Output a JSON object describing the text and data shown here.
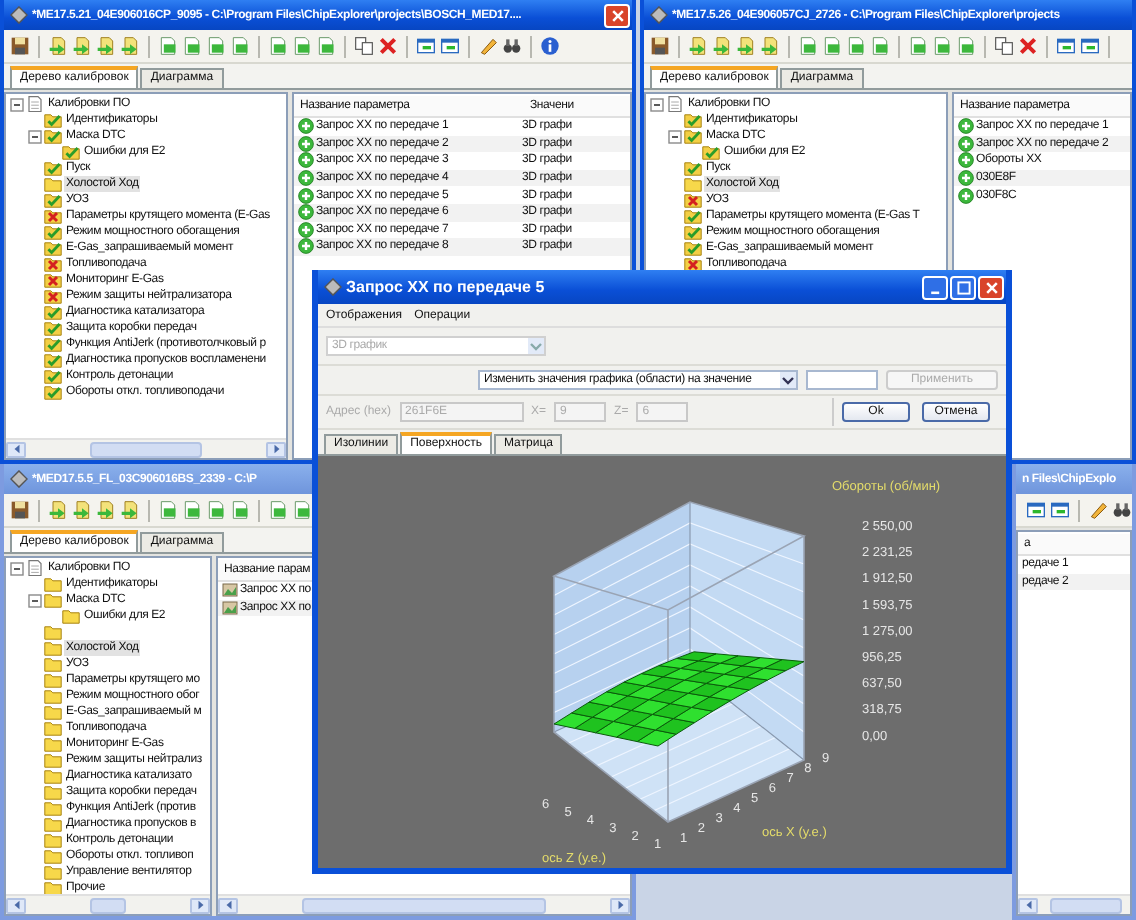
{
  "windows": [
    {
      "title": "*ME17.5.21_04E906016CP_9095 - C:\\Program Files\\ChipExplorer\\projects\\BOSCH_MED17....",
      "active": true,
      "close_button": true,
      "tabs": [
        {
          "label": "Дерево калибровок",
          "selected": true
        },
        {
          "label": "Диаграмма",
          "selected": false
        }
      ],
      "tree": [
        {
          "label": "Калибровки ПО",
          "kind": "root",
          "selected": false,
          "expanded": true,
          "children": [
            {
              "label": "Идентификаторы",
              "kind": "ok",
              "selected": false
            },
            {
              "label": "Маска DTC",
              "kind": "ok",
              "selected": false,
              "expanded": true,
              "children": [
                {
                  "label": "Ошибки для E2",
                  "kind": "ok",
                  "selected": false
                }
              ]
            },
            {
              "label": "Пуск",
              "kind": "ok",
              "selected": false
            },
            {
              "label": "Холостой Ход",
              "kind": "folder",
              "selected": true
            },
            {
              "label": "УОЗ",
              "kind": "ok",
              "selected": false
            },
            {
              "label": "Параметры крутящего момента (E-Gas",
              "kind": "error",
              "selected": false
            },
            {
              "label": "Режим мощностного обогащения",
              "kind": "ok",
              "selected": false
            },
            {
              "label": "E-Gas_запрашиваемый момент",
              "kind": "ok",
              "selected": false
            },
            {
              "label": "Топливоподача",
              "kind": "error",
              "selected": false
            },
            {
              "label": "Мониторинг E-Gas",
              "kind": "error",
              "selected": false
            },
            {
              "label": "Режим защиты нейтрализатора",
              "kind": "error",
              "selected": false
            },
            {
              "label": "Диагностика катализатора",
              "kind": "ok",
              "selected": false
            },
            {
              "label": "Защита коробки передач",
              "kind": "ok",
              "selected": false
            },
            {
              "label": "Функция AntiJerk (противотолчковый р",
              "kind": "ok",
              "selected": false
            },
            {
              "label": "Диагностика пропусков воспламенени",
              "kind": "ok",
              "selected": false
            },
            {
              "label": "Контроль детонации",
              "kind": "ok",
              "selected": false
            },
            {
              "label": "Обороты откл. топливоподачи",
              "kind": "ok",
              "selected": false
            }
          ]
        }
      ],
      "list": {
        "columns": [
          "Название параметра",
          "Значени"
        ],
        "rows": [
          {
            "kind": "ok",
            "cells": [
              "Запрос XX по передаче 1",
              "3D графи"
            ]
          },
          {
            "kind": "ok",
            "cells": [
              "Запрос XX по передаче 2",
              "3D графи"
            ]
          },
          {
            "kind": "ok",
            "cells": [
              "Запрос XX по передаче 3",
              "3D графи"
            ]
          },
          {
            "kind": "ok",
            "cells": [
              "Запрос XX по передаче 4",
              "3D графи"
            ]
          },
          {
            "kind": "ok",
            "cells": [
              "Запрос XX по передаче 5",
              "3D графи"
            ]
          },
          {
            "kind": "ok",
            "cells": [
              "Запрос XX по передаче 6",
              "3D графи"
            ]
          },
          {
            "kind": "ok",
            "cells": [
              "Запрос XX по передаче 7",
              "3D графи"
            ]
          },
          {
            "kind": "ok",
            "cells": [
              "Запрос XX по передаче 8",
              "3D графи"
            ]
          }
        ]
      }
    },
    {
      "title": "*ME17.5.26_04E906057CJ_2726 - C:\\Program Files\\ChipExplorer\\projects",
      "active": true,
      "close_button": false,
      "tabs": [
        {
          "label": "Дерево калибровок",
          "selected": true
        },
        {
          "label": "Диаграмма",
          "selected": false
        }
      ],
      "tree": [
        {
          "label": "Калибровки ПО",
          "kind": "root",
          "selected": false,
          "expanded": true,
          "children": [
            {
              "label": "Идентификаторы",
              "kind": "ok",
              "selected": false
            },
            {
              "label": "Маска DTC",
              "kind": "ok",
              "selected": false,
              "expanded": true,
              "children": [
                {
                  "label": "Ошибки для E2",
                  "kind": "ok",
                  "selected": false
                }
              ]
            },
            {
              "label": "Пуск",
              "kind": "ok",
              "selected": false
            },
            {
              "label": "Холостой Ход",
              "kind": "folder",
              "selected": true
            },
            {
              "label": "УОЗ",
              "kind": "error",
              "selected": false
            },
            {
              "label": "Параметры крутящего момента (E-Gas T",
              "kind": "ok",
              "selected": false
            },
            {
              "label": "Режим мощностного обогащения",
              "kind": "ok",
              "selected": false
            },
            {
              "label": "E-Gas_запрашиваемый момент",
              "kind": "ok",
              "selected": false
            },
            {
              "label": "Топливоподача",
              "kind": "error",
              "selected": false
            }
          ]
        }
      ],
      "list": {
        "columns": [
          "Название параметра"
        ],
        "rows": [
          {
            "kind": "ok",
            "cells": [
              "Запрос XX по передаче 1"
            ]
          },
          {
            "kind": "ok",
            "cells": [
              "Запрос XX по передаче 2"
            ]
          },
          {
            "kind": "ok",
            "cells": [
              "Обороты XX"
            ]
          },
          {
            "kind": "ok",
            "cells": [
              "030E8F"
            ]
          },
          {
            "kind": "ok",
            "cells": [
              "030F8C"
            ]
          }
        ]
      }
    },
    {
      "title": "*MED17.5.5_FL_03C906016BS_2339 - C:\\P",
      "active": false,
      "close_button": false,
      "tabs": [
        {
          "label": "Дерево калибровок",
          "selected": true
        },
        {
          "label": "Диаграмма",
          "selected": false
        }
      ],
      "tree": [
        {
          "label": "Калибровки ПО",
          "kind": "root",
          "selected": false,
          "expanded": true,
          "children": [
            {
              "label": "Идентификаторы",
              "kind": "folder",
              "selected": false
            },
            {
              "label": "Маска DTC",
              "kind": "folder",
              "selected": false,
              "expanded": true,
              "children": [
                {
                  "label": "Ошибки для E2",
                  "kind": "folder",
                  "selected": false
                }
              ]
            },
            {
              "kind": "folder",
              "selected": false
            },
            {
              "label": "Холостой Ход",
              "kind": "folder",
              "selected": true
            },
            {
              "label": "УОЗ",
              "kind": "folder",
              "selected": false
            },
            {
              "label": "Параметры крутящего мо",
              "kind": "folder",
              "selected": false
            },
            {
              "label": "Режим мощностного обог",
              "kind": "folder",
              "selected": false
            },
            {
              "label": "E-Gas_запрашиваемый м",
              "kind": "folder",
              "selected": false
            },
            {
              "label": "Топливоподача",
              "kind": "folder",
              "selected": false
            },
            {
              "label": "Мониторинг E-Gas",
              "kind": "folder",
              "selected": false
            },
            {
              "label": "Режим защиты нейтрализ",
              "kind": "folder",
              "selected": false
            },
            {
              "label": "Диагностика катализато",
              "kind": "folder",
              "selected": false
            },
            {
              "label": "Защита коробки передач",
              "kind": "folder",
              "selected": false
            },
            {
              "label": "Функция AntiJerk (против",
              "kind": "folder",
              "selected": false
            },
            {
              "label": "Диагностика пропусков в",
              "kind": "folder",
              "selected": false
            },
            {
              "label": "Контроль детонации",
              "kind": "folder",
              "selected": false
            },
            {
              "label": "Обороты откл. топливоп",
              "kind": "folder",
              "selected": false
            },
            {
              "label": "Управление вентилятор",
              "kind": "folder",
              "selected": false
            },
            {
              "label": "Прочие",
              "kind": "folder",
              "selected": false
            }
          ]
        }
      ],
      "list": {
        "columns": [
          "Название парам"
        ],
        "rows": [
          {
            "kind": "graph",
            "cells": [
              "Запрос XX по"
            ]
          },
          {
            "kind": "graph",
            "cells": [
              "Запрос XX по"
            ]
          }
        ]
      }
    },
    {
      "title": "n Files\\ChipExplo",
      "active": false,
      "close_button": false,
      "list": {
        "columns": [
          "а"
        ],
        "rows": [
          {
            "cells": [
              "редаче 1"
            ]
          },
          {
            "cells": [
              "редаче 2"
            ]
          }
        ]
      }
    }
  ],
  "dialog": {
    "title": "Запрос XX по передаче 5",
    "menu": [
      "Отображения",
      "Операции"
    ],
    "view_select": {
      "value": "3D график",
      "disabled": true
    },
    "operation_select": {
      "value": "Изменить значения графика (области) на значение"
    },
    "apply_button": {
      "label": "Применить",
      "disabled": true
    },
    "address": {
      "label": "Адрес (hex)",
      "value": "261F6E",
      "disabled": true
    },
    "x_field": {
      "label": "X=",
      "value": "9",
      "disabled": true
    },
    "z_field": {
      "label": "Z=",
      "value": "6",
      "disabled": true
    },
    "buttons": [
      {
        "label": "Ok",
        "disabled": false
      },
      {
        "label": "Отмена",
        "disabled": false
      }
    ],
    "tabs": [
      {
        "label": "Изолинии",
        "selected": false
      },
      {
        "label": "Поверхность",
        "selected": true
      },
      {
        "label": "Матрица",
        "selected": false
      }
    ],
    "plot": {
      "value_title": "Обороты (об/мин)",
      "value_ticks": [
        "2 550,00",
        "2 231,25",
        "1 912,50",
        "1 593,75",
        "1 275,00",
        "956,25",
        "637,50",
        "318,75",
        "0,00"
      ],
      "x_ticks": [
        "1",
        "2",
        "3",
        "4",
        "5",
        "6",
        "7",
        "8",
        "9"
      ],
      "x_label": "ось X (у.е.)",
      "z_ticks": [
        "1",
        "2",
        "3",
        "4",
        "5",
        "6"
      ],
      "z_label": "ось Z (у.е.)"
    }
  }
}
